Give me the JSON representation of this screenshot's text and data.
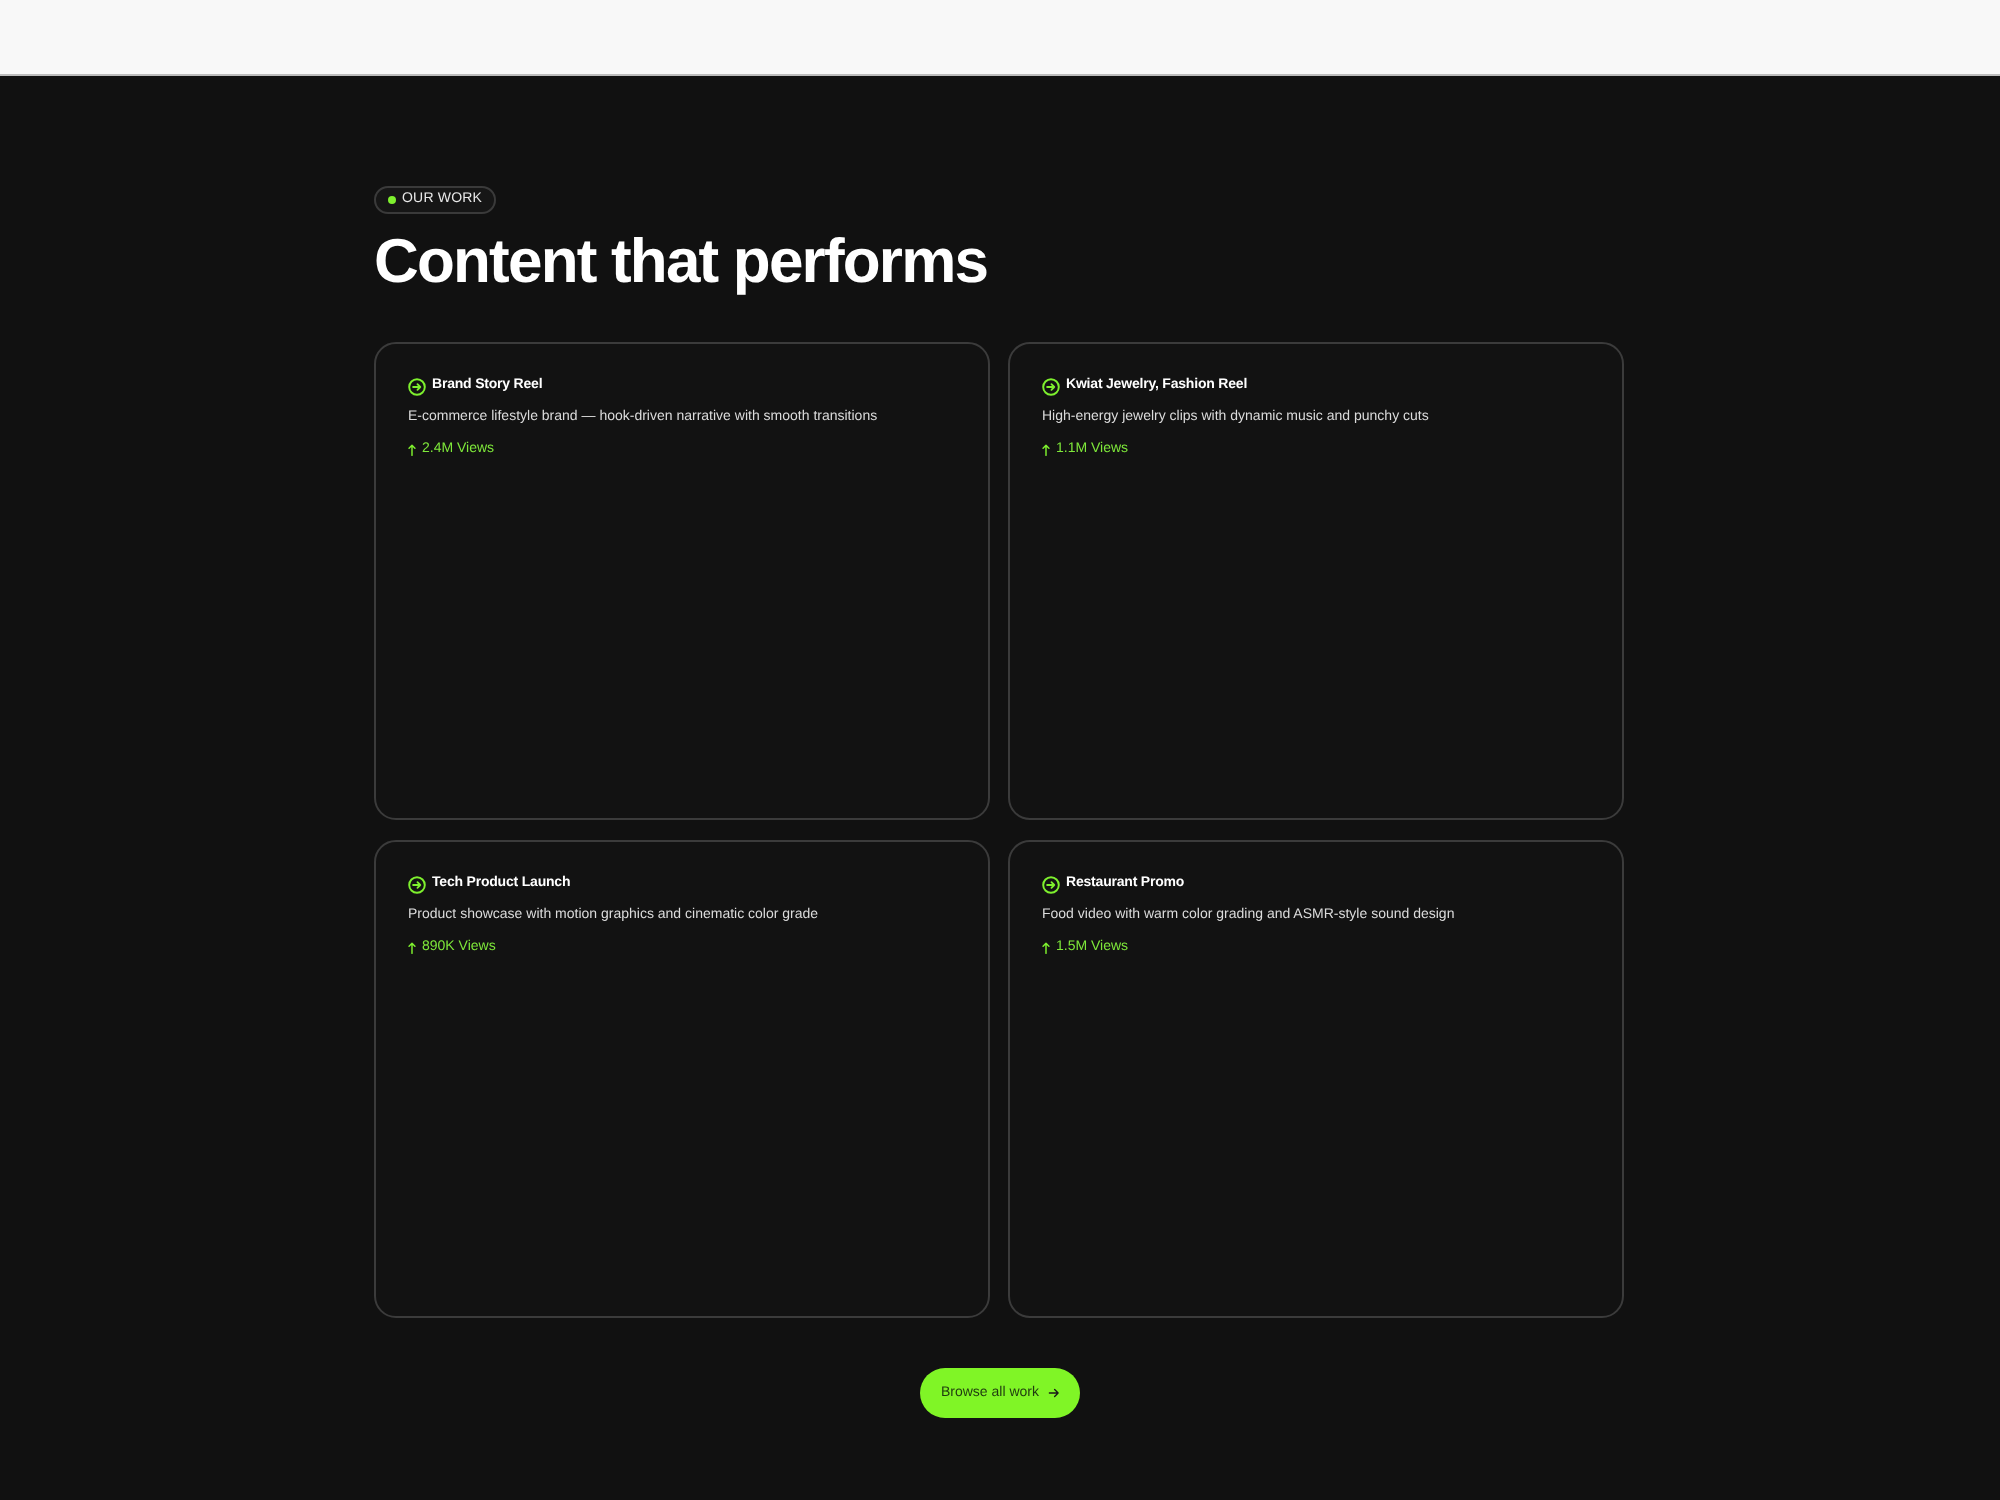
{
  "section": {
    "badge": {
      "label": "OUR WORK"
    },
    "heading": "Content that performs",
    "cards": [
      {
        "title": "Brand Story Reel",
        "description": "E-commerce lifestyle brand — hook-driven narrative with smooth transitions",
        "views": "2.4M Views"
      },
      {
        "title": "Kwiat Jewelry, Fashion Reel",
        "description": "High-energy jewelry clips with dynamic music and punchy cuts",
        "views": "1.1M Views"
      },
      {
        "title": "Tech Product Launch",
        "description": "Product showcase with motion graphics and cinematic color grade",
        "views": "890K Views"
      },
      {
        "title": "Restaurant Promo",
        "description": "Food video with warm color grading and ASMR-style sound design",
        "views": "1.5M Views"
      }
    ],
    "button": {
      "label": "Browse all work"
    }
  }
}
